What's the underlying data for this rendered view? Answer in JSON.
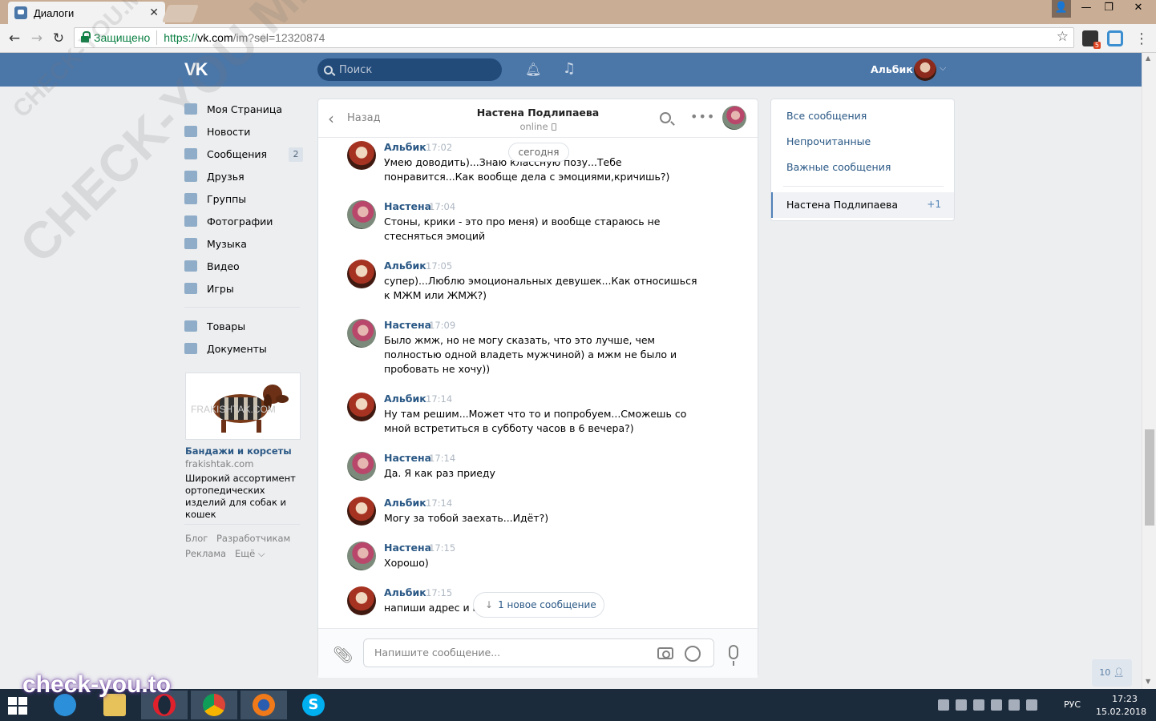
{
  "browser": {
    "tab_title": "Диалоги",
    "secure_label": "Защищено",
    "url_scheme": "https://",
    "url_host": "vk.com",
    "url_path": "/im?sel=12320874",
    "ext_badge": "5"
  },
  "header": {
    "logo": "VK",
    "search_placeholder": "Поиск",
    "user_name": "Альбик"
  },
  "sidebar": {
    "items": [
      {
        "label": "Моя Страница",
        "icon": "home-icon"
      },
      {
        "label": "Новости",
        "icon": "news-icon"
      },
      {
        "label": "Сообщения",
        "icon": "messages-icon",
        "badge": "2"
      },
      {
        "label": "Друзья",
        "icon": "friends-icon"
      },
      {
        "label": "Группы",
        "icon": "groups-icon"
      },
      {
        "label": "Фотографии",
        "icon": "photos-icon"
      },
      {
        "label": "Музыка",
        "icon": "music-icon"
      },
      {
        "label": "Видео",
        "icon": "video-icon"
      },
      {
        "label": "Игры",
        "icon": "games-icon"
      },
      {
        "label": "Товары",
        "icon": "goods-icon"
      },
      {
        "label": "Документы",
        "icon": "docs-icon"
      }
    ],
    "ad": {
      "image_text": "FRAKISHTAK.COM",
      "title": "Бандажи и корсеты",
      "domain": "frakishtak.com",
      "description": "Широкий ассортимент ортопедических изделий для собак и кошек"
    },
    "footer": [
      "Блог",
      "Разработчикам",
      "Реклама",
      "Ещё ⌵"
    ]
  },
  "chat": {
    "back_label": "Назад",
    "contact_name": "Настена Подлипаева",
    "status": "online",
    "date_divider": "сегодня",
    "messages": [
      {
        "author": "Альбик",
        "time": "17:02",
        "text": "Умею доводить)...Знаю классную позу...Тебе понравится...Как вообще дела с эмоциями,кричишь?)"
      },
      {
        "author": "Настена",
        "time": "17:04",
        "text": "Стоны, крики - это про меня) и вообще стараюсь не стесняться эмоций"
      },
      {
        "author": "Альбик",
        "time": "17:05",
        "text": "супер)...Люблю эмоциональных девушек...Как относишься к МЖМ или ЖМЖ?)"
      },
      {
        "author": "Настена",
        "time": "17:09",
        "text": "Было жмж, но не могу сказать, что это лучше, чем полностью одной владеть мужчиной) а мжм не было и пробовать не хочу))"
      },
      {
        "author": "Альбик",
        "time": "17:14",
        "text": "Ну там решим...Может что то и попробуем...Сможешь со мной встретиться в субботу часов в 6 вечера?)"
      },
      {
        "author": "Настена",
        "time": "17:14",
        "text": "Да. Я как раз приеду"
      },
      {
        "author": "Альбик",
        "time": "17:14",
        "text": "Могу за тобой заехать...Идёт?)"
      },
      {
        "author": "Настена",
        "time": "17:15",
        "text": "Хорошо)"
      },
      {
        "author": "Альбик",
        "time": "17:15",
        "text": "напиши адрес и но"
      }
    ],
    "new_message_label": "1 новое сообщение",
    "input_placeholder": "Напишите сообщение..."
  },
  "right_panel": {
    "items": [
      "Все сообщения",
      "Непрочитанные",
      "Важные сообщения"
    ],
    "active_dialog": "Настена Подлипаева",
    "active_count": "+1"
  },
  "friends_online": "10",
  "watermark": {
    "diagonal": "CHECK-YOU.ME",
    "bottom": "check-you.to"
  },
  "taskbar": {
    "lang": "РУС",
    "time": "17:23",
    "date": "15.02.2018"
  },
  "colors": {
    "vk_blue": "#4a76a8",
    "link": "#2a5885",
    "taskbar": "#1c2b3c"
  }
}
